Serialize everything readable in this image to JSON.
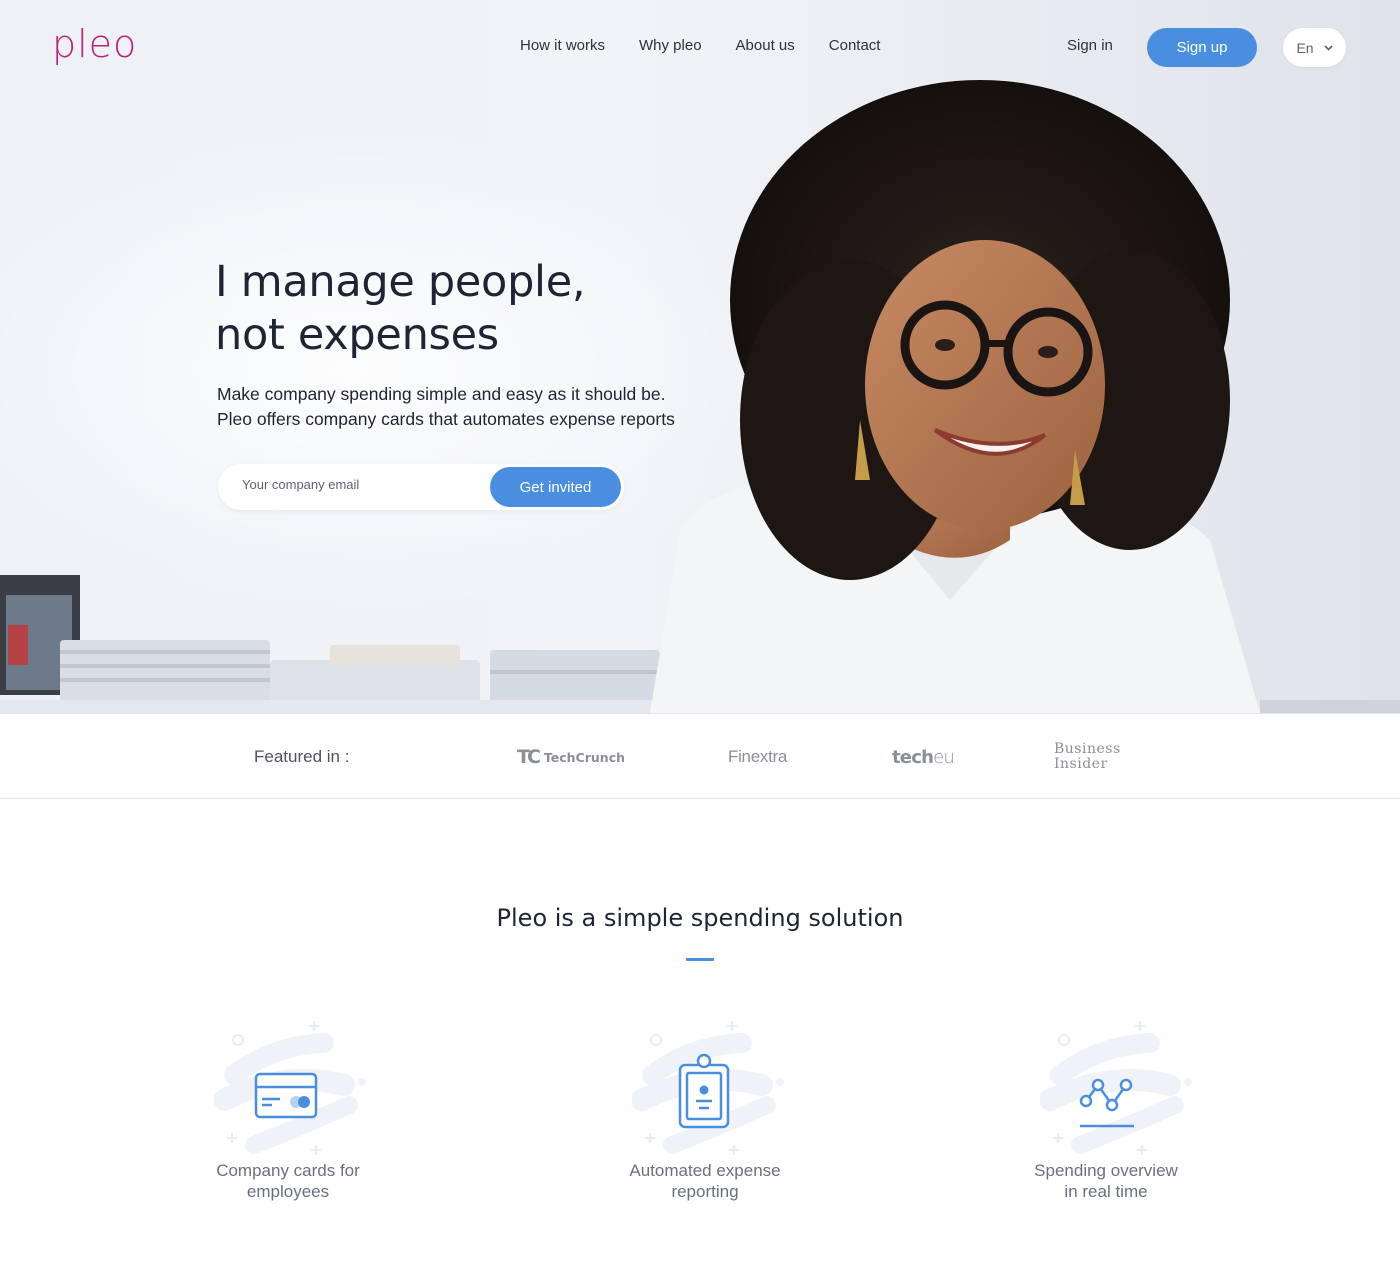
{
  "brand": {
    "logo_text": "pleo",
    "color": "#c0217a",
    "accent": "#4a8fdf"
  },
  "nav": {
    "items": [
      {
        "label": "How it works"
      },
      {
        "label": "Why pleo"
      },
      {
        "label": "About us"
      },
      {
        "label": "Contact"
      }
    ],
    "sign_in": "Sign in",
    "sign_up": "Sign up",
    "language": "En",
    "language_icon": "chevron-down-icon"
  },
  "hero": {
    "headline_line1": "I manage people,",
    "headline_line2": "not expenses",
    "subtext_line1": "Make company spending simple and easy as it should be.",
    "subtext_line2": "Pleo offers company cards that automates expense reports",
    "email_placeholder": "Your company email",
    "email_value": "",
    "cta": "Get invited"
  },
  "featured": {
    "label": "Featured in :",
    "logos": {
      "techcrunch_mark": "TC",
      "techcrunch": "TechCrunch",
      "finextra": "Finextra",
      "techeu_a": "tech",
      "techeu_b": "eu",
      "business_insider_line1": "Business",
      "business_insider_line2": "Insider"
    }
  },
  "solution": {
    "title": "Pleo is a simple spending solution",
    "features": [
      {
        "label_line1": "Company cards for",
        "label_line2": "employees",
        "icon": "credit-card-icon"
      },
      {
        "label_line1": "Automated expense",
        "label_line2": "reporting",
        "icon": "clipboard-receipt-icon"
      },
      {
        "label_line1": "Spending overview",
        "label_line2": "in real time",
        "icon": "line-chart-icon"
      }
    ]
  }
}
